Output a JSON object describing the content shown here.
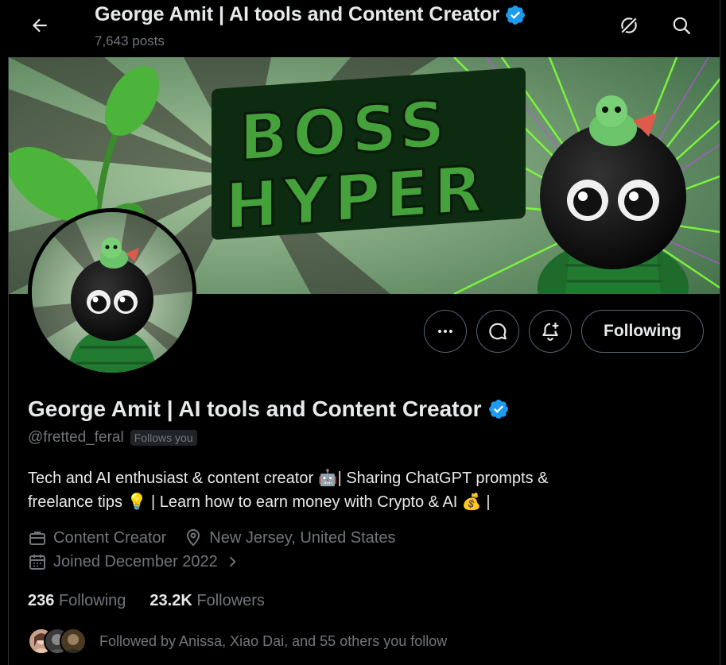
{
  "header": {
    "title": "George Amit | AI tools and Content Creator",
    "posts": "7,643 posts",
    "back_icon": "arrow-left-icon",
    "grok_icon": "grok-icon",
    "search_icon": "search-icon"
  },
  "banner": {
    "text_line1": "BOSS",
    "text_line2": "HYPER"
  },
  "actions": {
    "more_icon": "more-icon",
    "message_icon": "message-icon",
    "notify_icon": "bell-plus-icon",
    "following_label": "Following"
  },
  "profile": {
    "name": "George Amit | AI tools and Content Creator",
    "handle": "@fretted_feral",
    "follows_you": "Follows you",
    "bio_line1": "Tech and AI enthusiast & content creator 🤖| Sharing ChatGPT prompts &",
    "bio_line2": "freelance tips 💡 | Learn how to earn money with Crypto & AI 💰 |",
    "category": "Content Creator",
    "location": "New Jersey, United States",
    "joined": "Joined December 2022"
  },
  "stats": {
    "following_count": "236",
    "following_label": "Following",
    "followers_count": "23.2K",
    "followers_label": "Followers"
  },
  "followed_by": {
    "text": "Followed by Anissa, Xiao Dai, and 55 others you follow"
  },
  "colors": {
    "verified": "#1d9bf0",
    "muted": "#71767b",
    "text": "#e7e9ea",
    "border": "#536471"
  }
}
